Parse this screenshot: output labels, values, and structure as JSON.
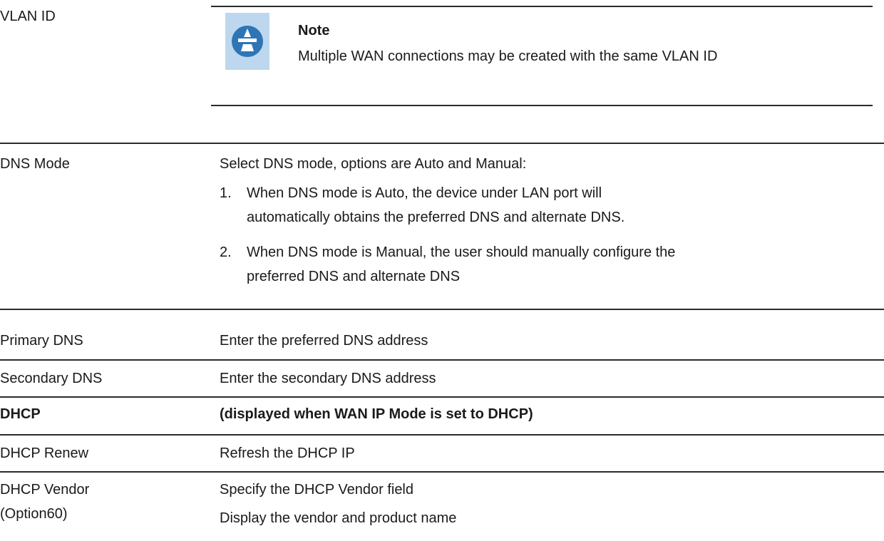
{
  "vlan": {
    "label": "VLAN ID",
    "note_title": "Note",
    "note_text": "Multiple WAN connections may be created with the same VLAN ID",
    "note_icon": "note-pencil-icon",
    "icon_color": "#2e75b6"
  },
  "dns_mode": {
    "label": "DNS Mode",
    "intro": "Select DNS mode, options are Auto and Manual:",
    "items": [
      {
        "num": "1.",
        "line1": "When DNS mode is Auto, the device under LAN port will",
        "line2": "automatically obtains the preferred DNS and alternate DNS."
      },
      {
        "num": "2.",
        "line1": "When DNS mode is Manual, the user should manually configure the",
        "line2": "preferred DNS and alternate DNS"
      }
    ]
  },
  "rows": [
    {
      "label": "Primary DNS",
      "desc": "Enter the preferred DNS address"
    },
    {
      "label": "Secondary DNS",
      "desc": "Enter the secondary DNS address"
    },
    {
      "label": "DHCP",
      "desc": "(displayed when WAN IP Mode is set to DHCP)"
    },
    {
      "label": "DHCP Renew",
      "desc": "Refresh the DHCP IP"
    }
  ],
  "vendor": {
    "label_line1": "DHCP Vendor",
    "label_line2": "(Option60)",
    "desc_line1": "Specify the DHCP Vendor field",
    "desc_line2": "Display the vendor and product name"
  }
}
